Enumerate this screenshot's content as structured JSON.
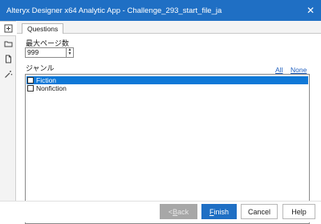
{
  "window": {
    "title": "Alteryx Designer x64 Analytic App - Challenge_293_start_file_ja",
    "close_glyph": "✕"
  },
  "tabs": [
    {
      "label": "Questions",
      "active": true
    }
  ],
  "sidebar": {
    "icons": [
      "app-icon",
      "folder-icon",
      "file-icon",
      "wand-icon"
    ]
  },
  "form": {
    "max_pages_label": "最大ページ数",
    "max_pages_value": "999",
    "genre_label": "ジャンル",
    "all_link": "All",
    "none_link": "None",
    "genres": [
      {
        "label": "Fiction",
        "checked": false,
        "selected": true
      },
      {
        "label": "Nonfiction",
        "checked": false,
        "selected": false
      }
    ]
  },
  "footer": {
    "back": {
      "prefix": "< ",
      "mnemonic": "B",
      "rest": "ack"
    },
    "finish": {
      "mnemonic": "F",
      "rest": "inish"
    },
    "cancel": "Cancel",
    "help": "Help"
  },
  "colors": {
    "titlebar": "#1f6fc4",
    "selection": "#0f78d7",
    "link": "#1f5fbf",
    "disabled_button": "#a7a7a7"
  }
}
